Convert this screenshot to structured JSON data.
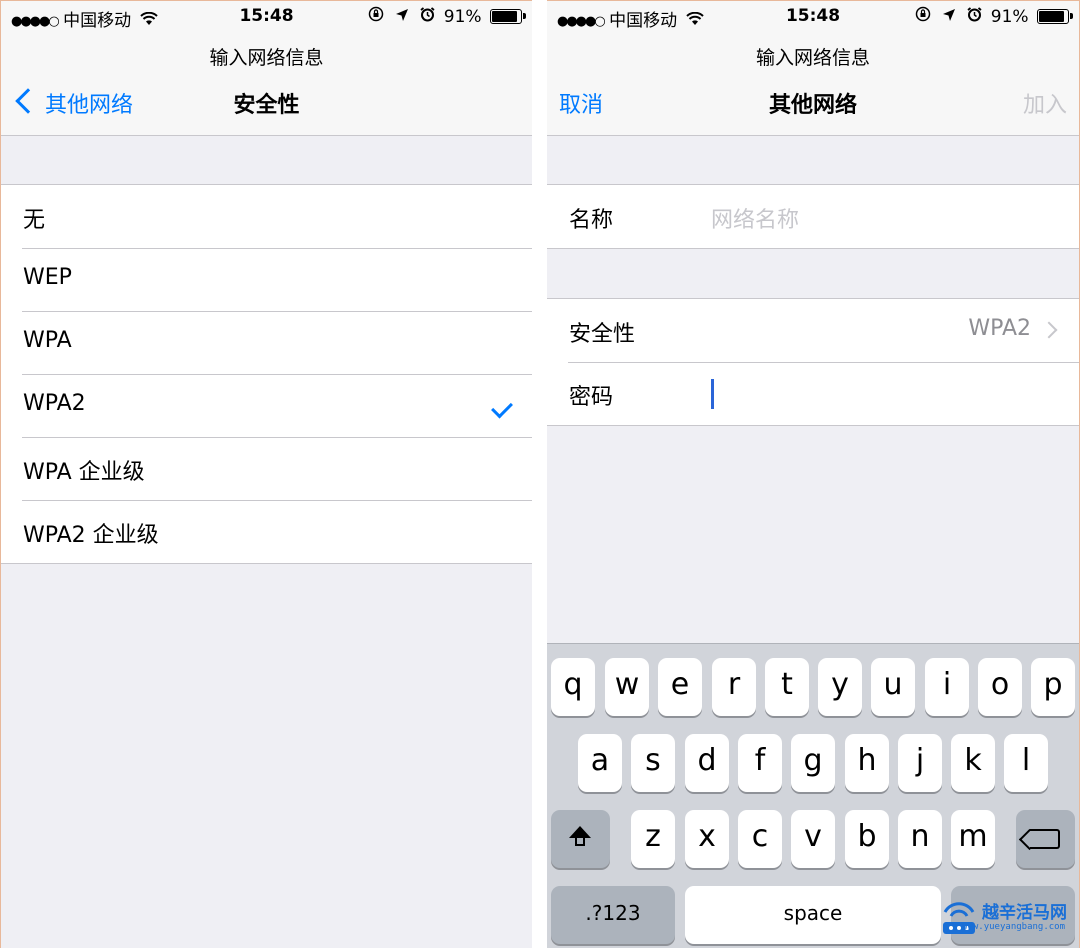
{
  "status_bar": {
    "carrier": "中国移动",
    "time": "15:48",
    "battery": "91%",
    "signal_icon": "signal-dots-icon",
    "wifi_icon": "wifi-icon",
    "rotation_lock_icon": "rotation-lock-icon",
    "location_icon": "location-icon",
    "alarm_icon": "alarm-icon"
  },
  "left": {
    "prompt": "输入网络信息",
    "back_label": "其他网络",
    "title": "安全性",
    "options": [
      {
        "label": "无",
        "selected": false
      },
      {
        "label": "WEP",
        "selected": false
      },
      {
        "label": "WPA",
        "selected": false
      },
      {
        "label": "WPA2",
        "selected": true
      },
      {
        "label": "WPA 企业级",
        "selected": false
      },
      {
        "label": "WPA2 企业级",
        "selected": false
      }
    ]
  },
  "right": {
    "prompt": "输入网络信息",
    "cancel_label": "取消",
    "title": "其他网络",
    "join_label": "加入",
    "name_label": "名称",
    "name_placeholder": "网络名称",
    "security_label": "安全性",
    "security_value": "WPA2",
    "password_label": "密码"
  },
  "keyboard": {
    "row1": [
      "q",
      "w",
      "e",
      "r",
      "t",
      "y",
      "u",
      "i",
      "o",
      "p"
    ],
    "row2": [
      "a",
      "s",
      "d",
      "f",
      "g",
      "h",
      "j",
      "k",
      "l"
    ],
    "row3": [
      "z",
      "x",
      "c",
      "v",
      "b",
      "n",
      "m"
    ],
    "numbers_label": ".?123",
    "space_label": "space"
  },
  "watermark": {
    "text": "越辛活马网",
    "url": "www.yueyangbang.com"
  },
  "colors": {
    "accent": "#007aff",
    "disabled": "#c7c7cc",
    "background": "#efeff4"
  }
}
